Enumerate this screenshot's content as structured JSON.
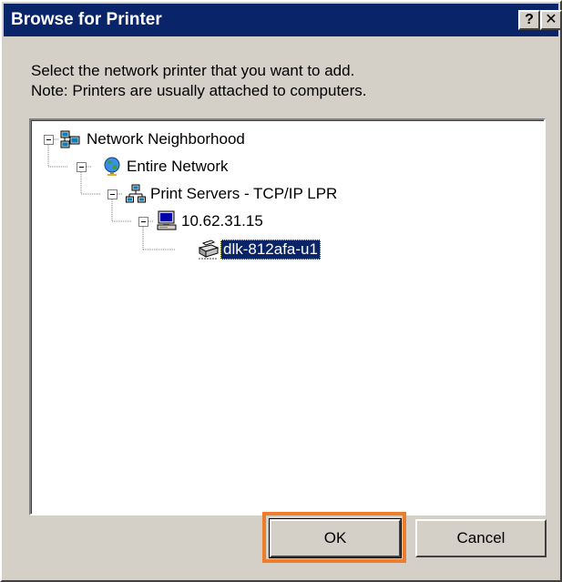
{
  "window": {
    "title": "Browse for Printer",
    "help_label": "?",
    "close_label": "✕"
  },
  "instructions": {
    "line1": "Select the network printer that you want to add.",
    "line2": "Note: Printers are usually attached to computers."
  },
  "tree": {
    "nodes": [
      {
        "label": "Network Neighborhood",
        "icon": "network-neighborhood-icon",
        "expanded": true
      },
      {
        "label": "Entire Network",
        "icon": "globe-icon",
        "expanded": true
      },
      {
        "label": "Print Servers - TCP/IP LPR",
        "icon": "print-servers-icon",
        "expanded": true
      },
      {
        "label": "10.62.31.15",
        "icon": "computer-icon",
        "expanded": true
      },
      {
        "label": "dlk-812afa-u1",
        "icon": "printer-icon",
        "selected": true
      }
    ]
  },
  "buttons": {
    "ok_label": "OK",
    "cancel_label": "Cancel"
  },
  "colors": {
    "titlebar": "#0a246a",
    "dialog_bg": "#d4d0c8",
    "selection": "#0a246a",
    "highlight_box": "#ee7d2c"
  }
}
